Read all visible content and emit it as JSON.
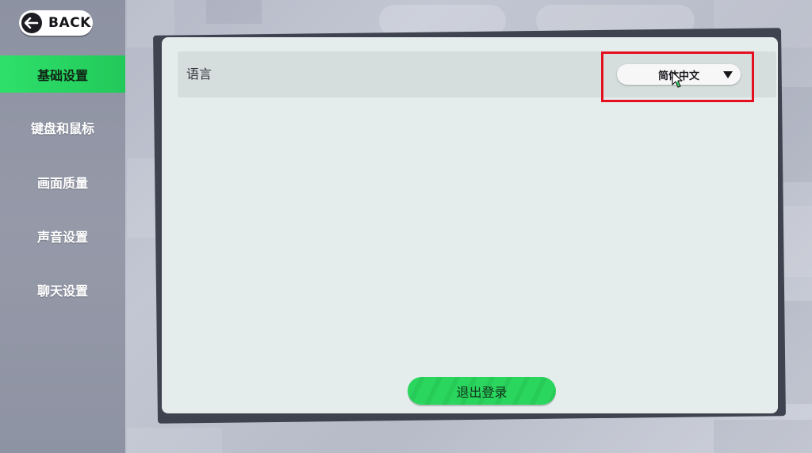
{
  "back": {
    "label": "BACK"
  },
  "sidebar": {
    "items": [
      {
        "label": "基础设置",
        "active": true
      },
      {
        "label": "键盘和鼠标",
        "active": false
      },
      {
        "label": "画面质量",
        "active": false
      },
      {
        "label": "声音设置",
        "active": false
      },
      {
        "label": "聊天设置",
        "active": false
      }
    ]
  },
  "settings": {
    "language": {
      "label": "语言",
      "selected": "简体中文"
    }
  },
  "logout": {
    "label": "退出登录"
  },
  "colors": {
    "accent_green": "#2bd65f",
    "highlight_red": "#e4101f",
    "panel_bg": "#e4ecec"
  }
}
